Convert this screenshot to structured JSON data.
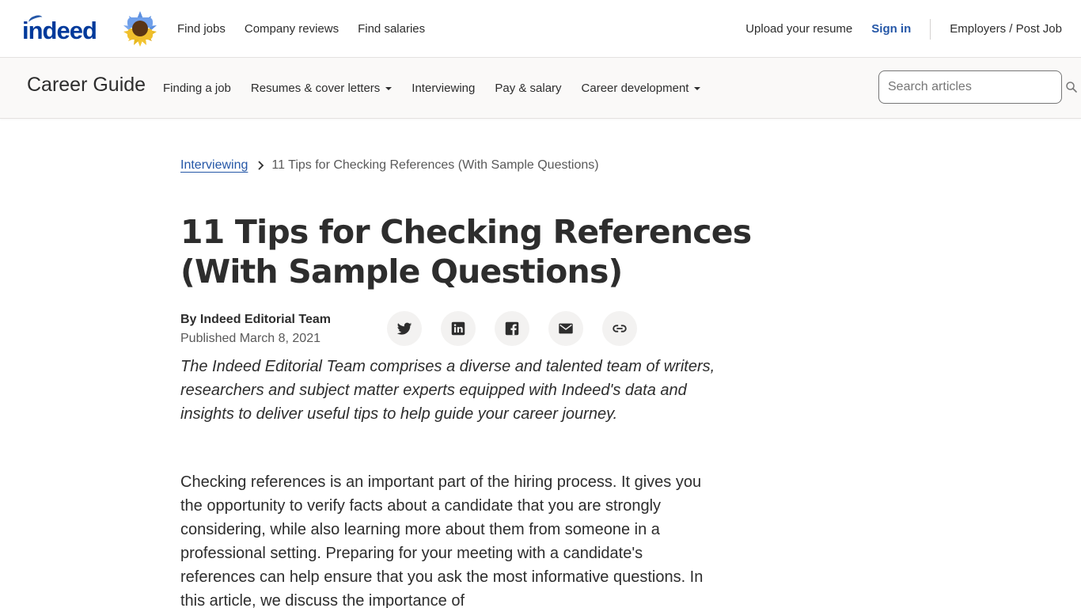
{
  "header": {
    "logo_text": "indeed",
    "nav_left": [
      {
        "label": "Find jobs"
      },
      {
        "label": "Company reviews"
      },
      {
        "label": "Find salaries"
      }
    ],
    "upload_resume": "Upload your resume",
    "sign_in": "Sign in",
    "employers": "Employers / Post Job",
    "brand_color": "#2557a7"
  },
  "guide": {
    "title": "Career Guide",
    "nav": [
      {
        "label": "Finding a job",
        "dropdown": false
      },
      {
        "label": "Resumes & cover letters",
        "dropdown": true
      },
      {
        "label": "Interviewing",
        "dropdown": false
      },
      {
        "label": "Pay & salary",
        "dropdown": false
      },
      {
        "label": "Career development",
        "dropdown": true
      }
    ],
    "search_placeholder": "Search articles",
    "search_value": ""
  },
  "breadcrumb": {
    "parent": "Interviewing",
    "current": "11 Tips for Checking References (With Sample Questions)"
  },
  "article": {
    "title": "11 Tips for Checking References (With Sample Questions)",
    "author": "By Indeed Editorial Team",
    "published": "Published March 8, 2021",
    "share_icons": [
      "twitter-icon",
      "linkedin-icon",
      "facebook-icon",
      "email-icon",
      "link-icon"
    ],
    "bio": "The Indeed Editorial Team comprises a diverse and talented team of writers, researchers and subject matter experts equipped with Indeed's data and insights to deliver useful tips to help guide your career journey.",
    "intro": "Checking references is an important part of the hiring process. It gives you the opportunity to verify facts about a candidate that you are strongly considering, while also learning more about them from someone in a professional setting. Preparing for your meeting with a candidate's references can help ensure that you ask the most informative questions. In this article, we discuss the importance of"
  }
}
